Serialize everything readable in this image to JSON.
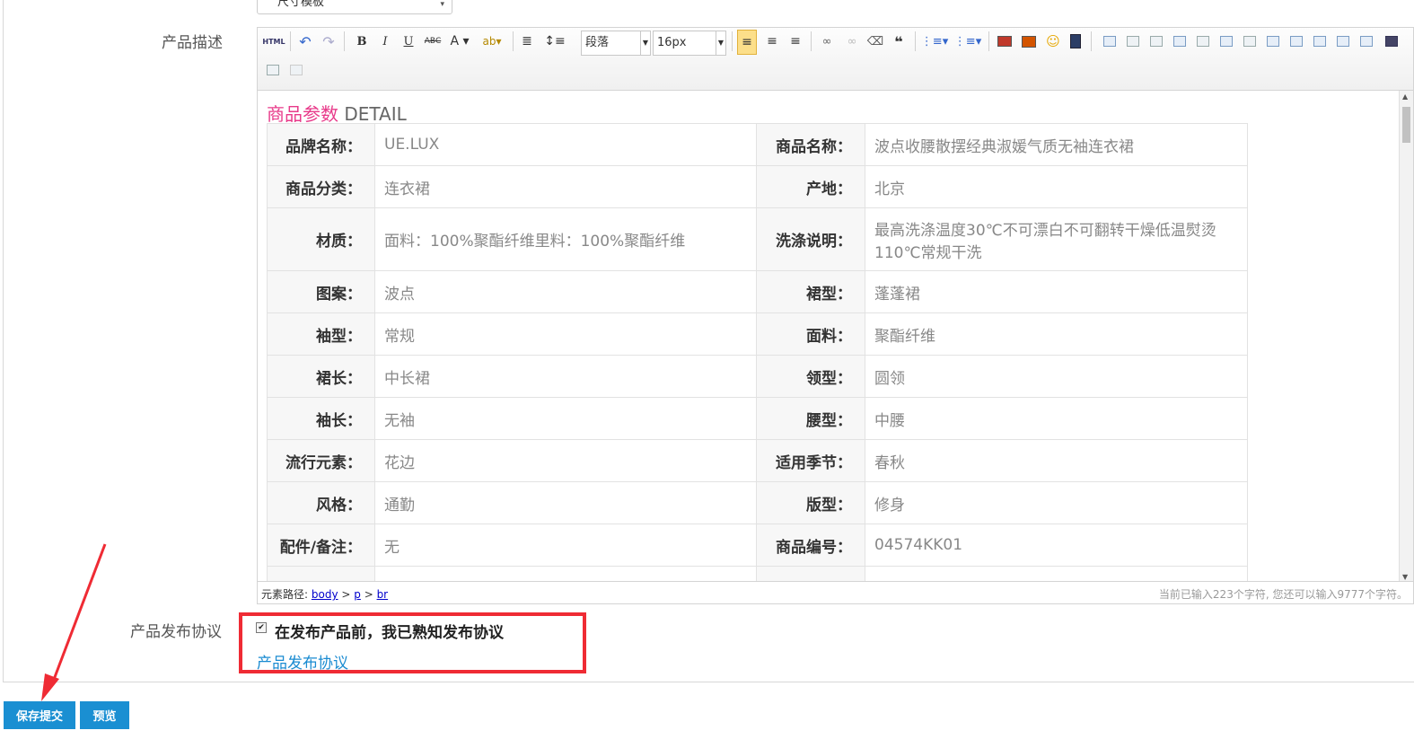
{
  "top_select": {
    "value": "尺寸模板"
  },
  "form": {
    "description_label": "产品描述",
    "agreement_label": "产品发布协议",
    "agreement_checkbox_text": "在发布产品前，我已熟知发布协议",
    "agreement_checked": true,
    "agreement_link": "产品发布协议"
  },
  "toolbar": {
    "html_label": "HTML",
    "paragraph_value": "段落",
    "font_size_value": "16px",
    "icons": [
      "source-html-icon",
      "undo-icon",
      "redo-icon",
      "bold-icon",
      "italic-icon",
      "underline-icon",
      "strikethrough-icon",
      "font-color-icon",
      "highlight-color-icon",
      "indent-icon",
      "line-height-icon",
      "paragraph-format-select",
      "font-size-select",
      "align-left-icon",
      "align-center-icon",
      "align-right-icon",
      "link-icon",
      "unlink-icon",
      "eraser-icon",
      "blockquote-icon",
      "ordered-list-icon",
      "unordered-list-icon",
      "image-icon",
      "multi-image-icon",
      "emoticon-icon",
      "video-icon",
      "table-icons"
    ]
  },
  "content": {
    "title_cn": "商品参数",
    "title_en": "DETAIL",
    "rows": [
      {
        "k1": "品牌名称：",
        "v1": "UE.LUX",
        "k2": "商品名称：",
        "v2": "波点收腰散摆经典淑媛气质无袖连衣裙"
      },
      {
        "k1": "商品分类：",
        "v1": "连衣裙",
        "k2": "产地：",
        "v2": "北京"
      },
      {
        "k1": "材质：",
        "v1": "面料：100%聚酯纤维里料：100%聚酯纤维",
        "k2": "洗涤说明：",
        "v2": "最高洗涤温度30℃不可漂白不可翻转干燥低温熨烫110℃常规干洗"
      },
      {
        "k1": "图案：",
        "v1": "波点",
        "k2": "裙型：",
        "v2": "蓬蓬裙"
      },
      {
        "k1": "袖型：",
        "v1": "常规",
        "k2": "面料：",
        "v2": "聚酯纤维"
      },
      {
        "k1": "裙长：",
        "v1": "中长裙",
        "k2": "领型：",
        "v2": "圆领"
      },
      {
        "k1": "袖长：",
        "v1": "无袖",
        "k2": "腰型：",
        "v2": "中腰"
      },
      {
        "k1": "流行元素：",
        "v1": "花边",
        "k2": "适用季节：",
        "v2": "春秋"
      },
      {
        "k1": "风格：",
        "v1": "通勤",
        "k2": "版型：",
        "v2": "修身"
      },
      {
        "k1": "配件/备注：",
        "v1": "无",
        "k2": "商品编号：",
        "v2": "04574KK01"
      },
      {
        "k1": "",
        "v1": "",
        "k2": "",
        "v2": ""
      }
    ]
  },
  "statusbar": {
    "path_label": "元素路径:",
    "path": [
      "body",
      "p",
      "br"
    ],
    "char_count": "当前已输入223个字符, 您还可以输入9777个字符。"
  },
  "buttons": {
    "save": "保存提交",
    "preview": "预览"
  },
  "colors": {
    "accent": "#1a8fd2",
    "highlight_box": "#ef2b34",
    "title_pink": "#e83a8a"
  }
}
